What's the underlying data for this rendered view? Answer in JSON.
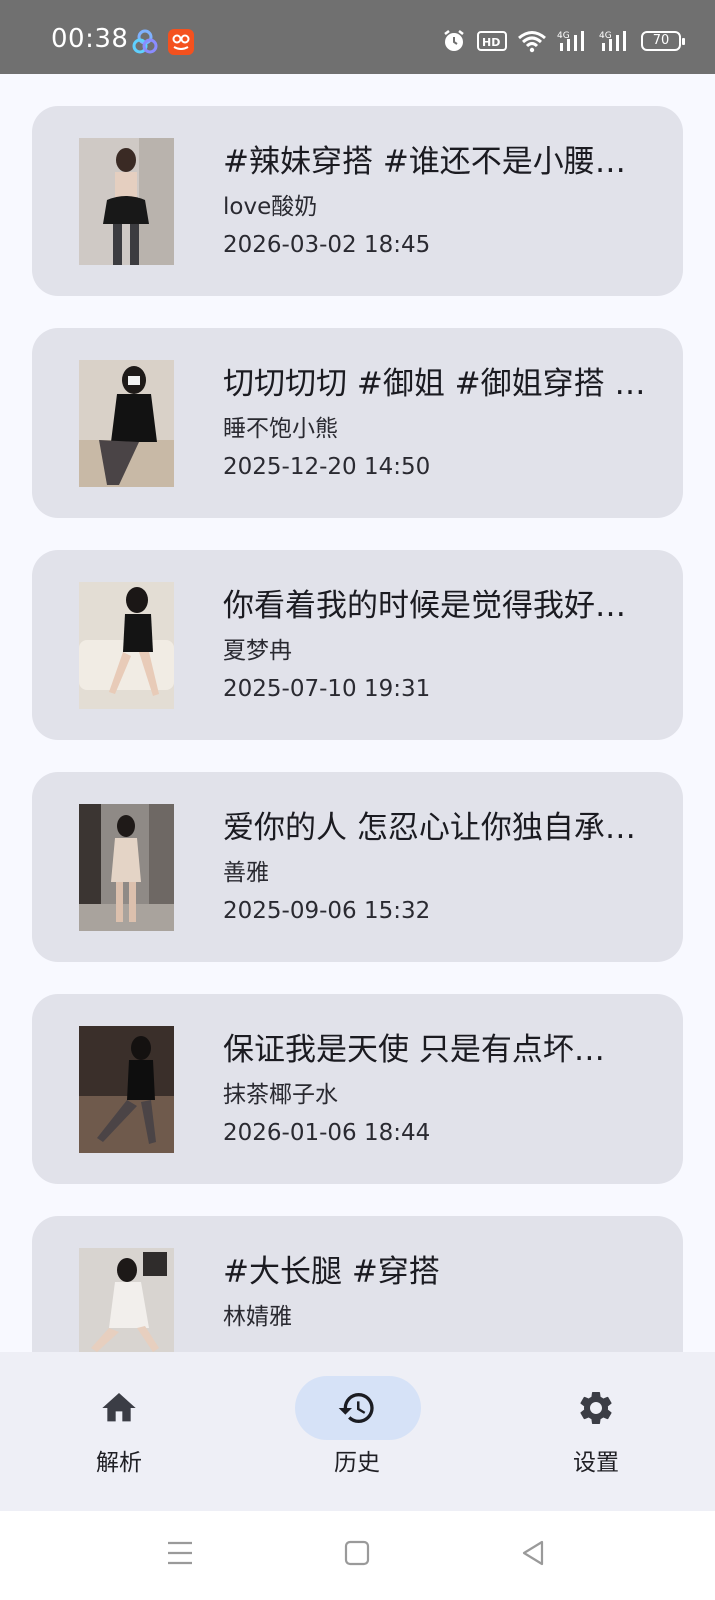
{
  "status_bar": {
    "time": "00:38",
    "battery": "70",
    "icons": [
      "app-icon",
      "app-icon",
      "alarm-icon",
      "hd-voice-icon",
      "wifi-icon",
      "signal-4g-icon",
      "signal-4g-icon",
      "battery-icon"
    ]
  },
  "history": {
    "items": [
      {
        "title": "#辣妹穿搭 #谁还不是小腰精…",
        "author": "love酸奶",
        "date": "2026-03-02 18:45"
      },
      {
        "title": "切切切切 #御姐 #御姐穿搭 #…",
        "author": "睡不饱小熊",
        "date": "2025-12-20 14:50"
      },
      {
        "title": "你看着我的时候是觉得我好…",
        "author": "夏梦冉",
        "date": "2025-07-10 19:31"
      },
      {
        "title": "爱你的人 怎忍心让你独自承…",
        "author": "善雅",
        "date": "2025-09-06 15:32"
      },
      {
        "title": "保证我是天使 只是有点坏…",
        "author": "抹茶椰子水",
        "date": "2026-01-06 18:44"
      },
      {
        "title": "#大长腿  #穿搭",
        "author": "林婧雅",
        "date": ""
      }
    ]
  },
  "bottom_nav": {
    "items": [
      {
        "label": "解析",
        "icon": "home-icon",
        "active": false
      },
      {
        "label": "历史",
        "icon": "history-icon",
        "active": true
      },
      {
        "label": "设置",
        "icon": "gear-icon",
        "active": false
      }
    ]
  },
  "system_nav": {
    "icons": [
      "menu-icon",
      "home-square-icon",
      "back-triangle-icon"
    ]
  },
  "colors": {
    "card_background": "#e1e2ea",
    "page_background": "#f8f9ff",
    "nav_background": "#eeeff6",
    "active_pill": "#d6e2f7",
    "status_bar": "#707070"
  }
}
